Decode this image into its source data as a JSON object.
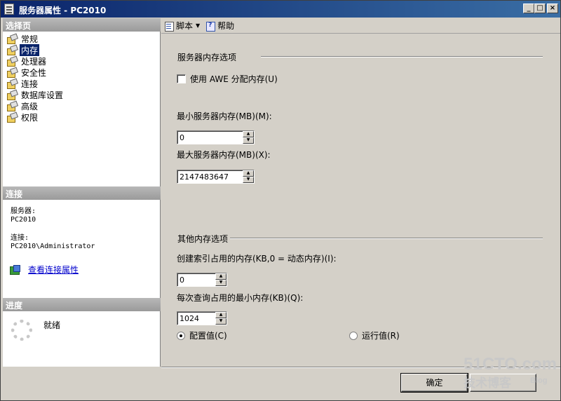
{
  "window": {
    "title": "服务器属性 - PC2010",
    "min_glyph": "_",
    "max_glyph": "□",
    "close_glyph": "×"
  },
  "left": {
    "select_page_header": "选择页",
    "nav_items": [
      {
        "label": "常规",
        "selected": false
      },
      {
        "label": "内存",
        "selected": true
      },
      {
        "label": "处理器",
        "selected": false
      },
      {
        "label": "安全性",
        "selected": false
      },
      {
        "label": "连接",
        "selected": false
      },
      {
        "label": "数据库设置",
        "selected": false
      },
      {
        "label": "高级",
        "selected": false
      },
      {
        "label": "权限",
        "selected": false
      }
    ],
    "connection_header": "连接",
    "server_label": "服务器:",
    "server_value": "PC2010",
    "connection_label": "连接:",
    "connection_value": "PC2010\\Administrator",
    "view_connection_link": "查看连接属性",
    "progress_header": "进度",
    "progress_status": "就绪"
  },
  "toolbar": {
    "script_label": "脚本",
    "help_label": "帮助"
  },
  "memory": {
    "server_memory_group": "服务器内存选项",
    "use_awe_label": "使用 AWE 分配内存(U)",
    "use_awe_checked": false,
    "min_memory_label": "最小服务器内存(MB)(M):",
    "min_memory_value": "0",
    "max_memory_label": "最大服务器内存(MB)(X):",
    "max_memory_value": "2147483647",
    "other_group": "其他内存选项",
    "index_memory_label": "创建索引占用的内存(KB,0 = 动态内存)(I):",
    "index_memory_value": "0",
    "min_query_label": "每次查询占用的最小内存(KB)(Q):",
    "min_query_value": "1024",
    "configured_label": "配置值(C)",
    "running_label": "运行值(R)",
    "selected_mode": "configured"
  },
  "buttons": {
    "ok_label": "确定"
  },
  "watermark": {
    "line1": "51CTO.com",
    "line2": "技术博客",
    "line3": "Blog"
  }
}
